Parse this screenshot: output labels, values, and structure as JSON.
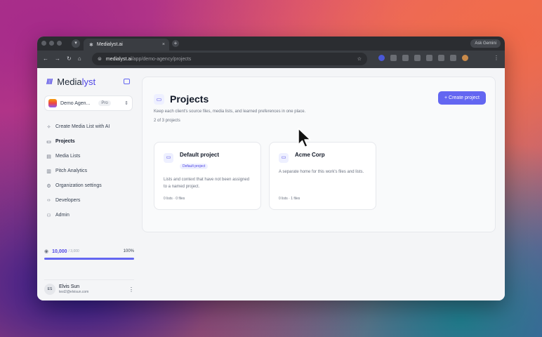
{
  "browser": {
    "tab_title": "Medialyst.ai",
    "tab_close": "×",
    "new_tab": "+",
    "ask_gemini": "Ask Gemini",
    "url_host": "medialyst.ai",
    "url_path": "/app/demo-agency/projects",
    "nav": {
      "back": "←",
      "forward": "→",
      "reload": "↻",
      "home": "⌂"
    },
    "star": "☆",
    "menu": "⋮"
  },
  "sidebar": {
    "logo_icon": "////",
    "logo_main": "Media",
    "logo_accent": "lyst",
    "org": {
      "name": "Demo Agen...",
      "plan": "Pro",
      "chevron": "⇕"
    },
    "items": [
      {
        "label": "Create Media List with AI",
        "icon": "sparkles-icon",
        "glyph": "✧"
      },
      {
        "label": "Projects",
        "icon": "folder-icon",
        "glyph": "▭",
        "active": true
      },
      {
        "label": "Media Lists",
        "icon": "list-icon",
        "glyph": "▤"
      },
      {
        "label": "Pitch Analytics",
        "icon": "chart-icon",
        "glyph": "▥"
      },
      {
        "label": "Organization settings",
        "icon": "gear-icon",
        "glyph": "⚙"
      },
      {
        "label": "Developers",
        "icon": "code-icon",
        "glyph": "‹›"
      },
      {
        "label": "Admin",
        "icon": "users-icon",
        "glyph": "⚇"
      }
    ],
    "credits": {
      "used": "10,000",
      "total": "/ 3,000",
      "percent": "100%",
      "fill": 1.0,
      "eye": "◉"
    },
    "user": {
      "initials": "ES",
      "name": "Elvis Sun",
      "email": "test2@elvisun.com",
      "menu": "⋮"
    }
  },
  "main": {
    "title": "Projects",
    "create_button": "+ Create project",
    "subtitle": "Keep each client's source files, media lists, and learned preferences in one place.",
    "count": "2 of 3 projects",
    "cards": [
      {
        "name": "Default project",
        "badge": "Default project",
        "description": "Lists and context that have not been assigned to a named project.",
        "meta": "0 lists · 0 files"
      },
      {
        "name": "Acme Corp",
        "badge": "",
        "description": "A separate home for this work's files and lists.",
        "meta": "0 lists · 1 files"
      }
    ]
  },
  "colors": {
    "accent": "#6366f1",
    "brand": "#4f46e5"
  }
}
